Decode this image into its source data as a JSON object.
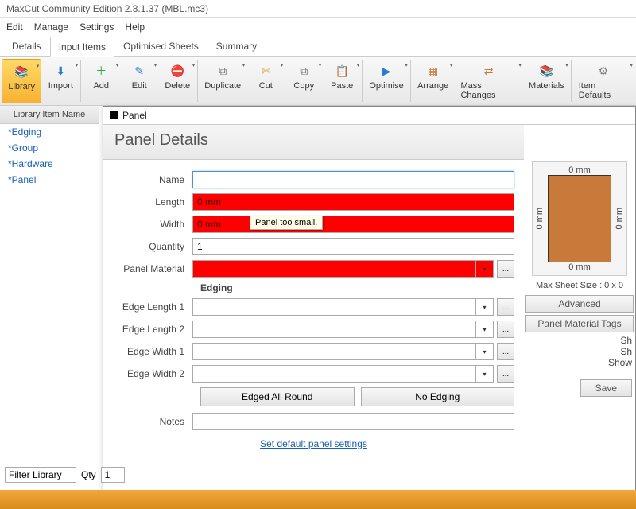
{
  "window": {
    "title": "MaxCut Community Edition 2.8.1.37 (MBL.mc3)"
  },
  "menu": [
    "Edit",
    "Manage",
    "Settings",
    "Help"
  ],
  "page_tabs": [
    "Details",
    "Input Items",
    "Optimised Sheets",
    "Summary"
  ],
  "active_page_tab": 1,
  "tools": [
    {
      "label": "Library",
      "glyph": "📚",
      "color": "#c97a3a",
      "selected": true
    },
    {
      "label": "Import",
      "glyph": "⬇",
      "color": "#2a7ad4"
    },
    {
      "label": "Add",
      "glyph": "＋",
      "color": "#2fa83a"
    },
    {
      "label": "Edit",
      "glyph": "✎",
      "color": "#2a7ad4"
    },
    {
      "label": "Delete",
      "glyph": "⛔",
      "color": "#d43a2f"
    },
    {
      "label": "Duplicate",
      "glyph": "⧉",
      "color": "#777"
    },
    {
      "label": "Cut",
      "glyph": "✄",
      "color": "#e09b2a"
    },
    {
      "label": "Copy",
      "glyph": "⧉",
      "color": "#777"
    },
    {
      "label": "Paste",
      "glyph": "📋",
      "color": "#c97a3a"
    },
    {
      "label": "Optimise",
      "glyph": "▶",
      "color": "#2a7ad4"
    },
    {
      "label": "Arrange",
      "glyph": "▦",
      "color": "#c97a3a"
    },
    {
      "label": "Mass Changes",
      "glyph": "⇄",
      "color": "#c97a3a"
    },
    {
      "label": "Materials",
      "glyph": "📚",
      "color": "#c97a3a"
    },
    {
      "label": "Item Defaults",
      "glyph": "⚙",
      "color": "#777"
    }
  ],
  "library": {
    "header": "Library Item Name",
    "items": [
      "*Edging",
      "*Group",
      "*Hardware",
      "*Panel"
    ]
  },
  "panel": {
    "title": "Panel",
    "heading": "Panel Details",
    "labels": {
      "name": "Name",
      "length": "Length",
      "width": "Width",
      "quantity": "Quantity",
      "material": "Panel Material",
      "edging": "Edging",
      "el1": "Edge Length 1",
      "el2": "Edge Length 2",
      "ew1": "Edge Width 1",
      "ew2": "Edge Width 2",
      "notes": "Notes"
    },
    "values": {
      "name": "",
      "length": "0 mm",
      "width": "0 mm",
      "quantity": "1",
      "material": "",
      "el1": "",
      "el2": "",
      "ew1": "",
      "ew2": "",
      "notes": ""
    },
    "buttons": {
      "edged": "Edged All Round",
      "noedge": "No Edging"
    },
    "tooltip": "Panel too small.",
    "defaults_link": "Set default panel settings",
    "ellipsis": "..."
  },
  "preview": {
    "top": "0 mm",
    "bottom": "0 mm",
    "left": "0 mm",
    "right": "0 mm",
    "sheet_label": "Max Sheet Size : 0 x 0",
    "advanced": "Advanced",
    "tags": "Panel Material Tags",
    "show1": "Sh",
    "show2": "Sh",
    "show3": "Show",
    "save": "Save"
  },
  "footer": {
    "filter": "Filter Library",
    "qty_label": "Qty",
    "qty": "1"
  }
}
